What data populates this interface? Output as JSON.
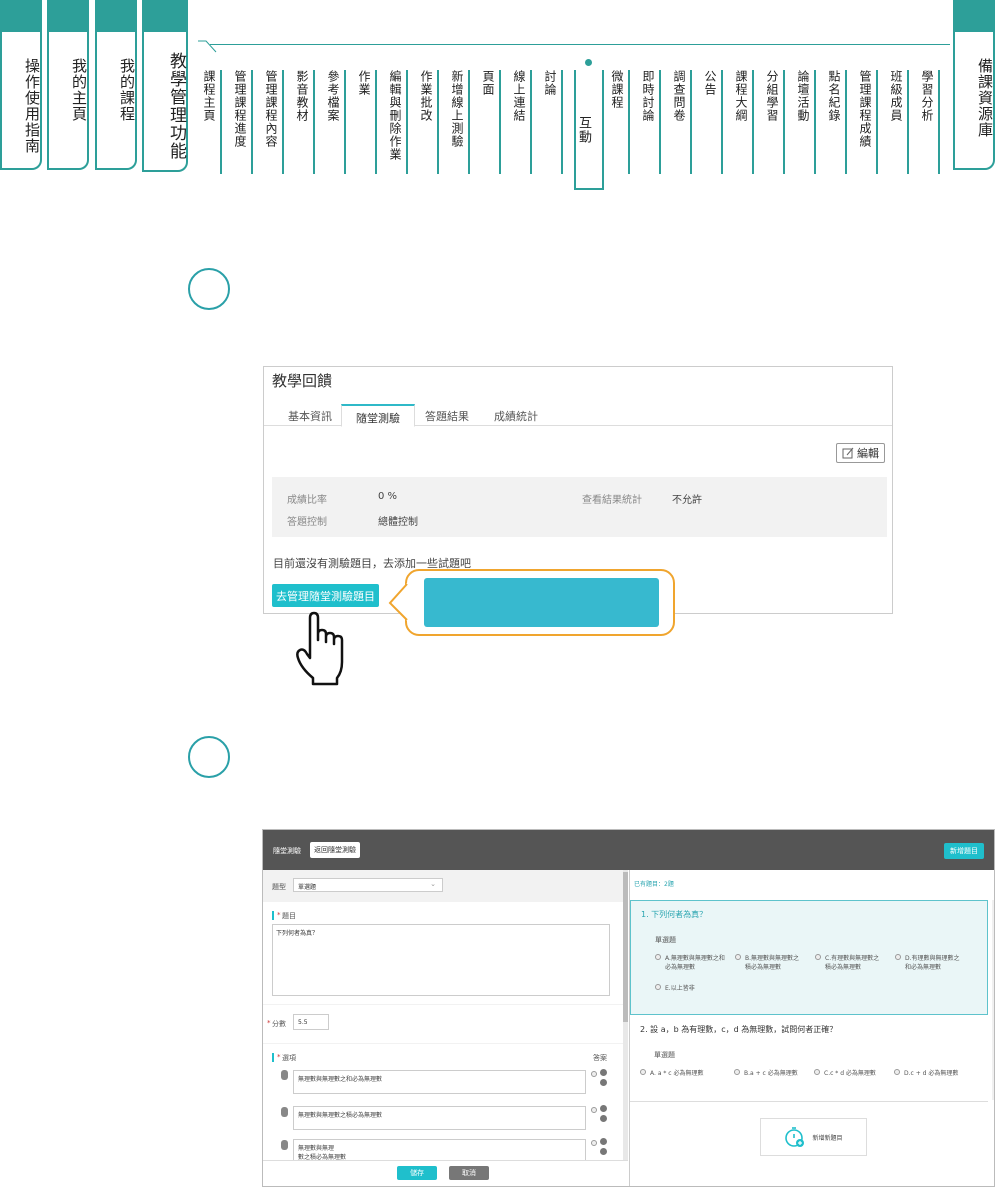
{
  "nav": {
    "big_tabs": [
      {
        "label": "操作使用指南"
      },
      {
        "label": "我的主頁"
      },
      {
        "label": "我的課程"
      },
      {
        "label": "教學管理功能"
      }
    ],
    "sub_tabs": [
      {
        "label": "課程主頁"
      },
      {
        "label": "管理課程進度"
      },
      {
        "label": "管理課程內容"
      },
      {
        "label": "影音教材"
      },
      {
        "label": "參考檔案"
      },
      {
        "label": "作業"
      },
      {
        "label": "編輯與刪除作業"
      },
      {
        "label": "作業批改"
      },
      {
        "label": "新增線上測驗"
      },
      {
        "label": "頁面"
      },
      {
        "label": "線上連結"
      },
      {
        "label": "討論"
      },
      {
        "label": "互動"
      },
      {
        "label": "微課程"
      },
      {
        "label": "即時討論"
      },
      {
        "label": "調查問卷"
      },
      {
        "label": "公告"
      },
      {
        "label": "課程大綱"
      },
      {
        "label": "分組學習"
      },
      {
        "label": "論壇活動"
      },
      {
        "label": "點名紀錄"
      },
      {
        "label": "管理課程成績"
      },
      {
        "label": "班級成員"
      },
      {
        "label": "學習分析"
      }
    ],
    "right_tab": {
      "label": "備課資源庫"
    }
  },
  "panel1": {
    "title": "教學回饋",
    "tabs": [
      {
        "label": "基本資訊"
      },
      {
        "label": "隨堂測驗"
      },
      {
        "label": "答題結果"
      },
      {
        "label": "成績統計"
      }
    ],
    "edit_label": "編輯",
    "fields": {
      "score_ratio_label": "成績比率",
      "score_ratio_value": "0 %",
      "view_stats_label": "查看結果統計",
      "view_stats_value": "不允許",
      "answer_control_label": "答題控制",
      "answer_control_value": "總體控制"
    },
    "empty_msg": "目前還沒有測驗題目，去添加一些試題吧",
    "manage_button": "去管理隨堂測驗題目"
  },
  "panel2": {
    "header_title": "隨堂測驗",
    "back_button": "返回隨堂測驗",
    "new_button": "新增題目",
    "type_label": "題型",
    "type_value": "單選題",
    "question_label": "題目",
    "question_value": "下列何者為真？",
    "score_label": "分數",
    "score_value": "5.5",
    "options_label": "選項",
    "answer_label": "答案",
    "options": [
      {
        "text": "無理數與無理數之和必為無理數"
      },
      {
        "text": "無理數與無理數之積必為無理數"
      },
      {
        "text": "無理數與無理\n數之積必為無理數"
      }
    ],
    "save_button": "儲存",
    "cancel_button": "取消",
    "count_text": "已有題目：2題",
    "q1": {
      "title": "1.  下列何者為真？",
      "type": "單選題",
      "choices": [
        "A.無理數與無理數之和必為無理數",
        "B.無理數與無理數之積必為無理數",
        "C.有理數與無理數之積必為無理數",
        "D.有理數與無理數之和必為無理數",
        "E.以上皆非"
      ]
    },
    "q2": {
      "title": "2.  設 a，b 為有理數，c，d 為無理數，試問何者正確？",
      "type": "單選題",
      "choices": [
        "A. a * c 必為無理數",
        "B.a + c 必為無理數",
        "C.c * d 必為無理數",
        "D.c + d 必為無理數"
      ]
    },
    "add_new": "新增新題目"
  },
  "colors": {
    "teal": "#2d9f99",
    "cyan": "#1fbfcc",
    "orange": "#f0a52e",
    "callout_fill": "#37b9cf",
    "header_dark": "#555555"
  }
}
